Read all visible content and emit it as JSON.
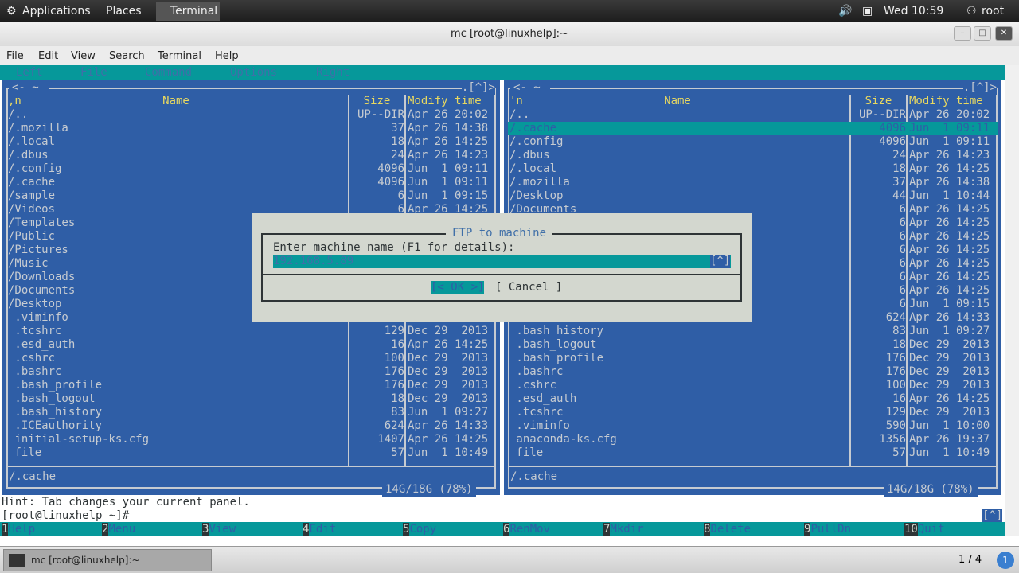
{
  "topbar": {
    "applications": "Applications",
    "places": "Places",
    "terminal": "Terminal",
    "clock": "Wed 10:59",
    "user": "root"
  },
  "window": {
    "title": "mc [root@linuxhelp]:~"
  },
  "menu": [
    "File",
    "Edit",
    "View",
    "Search",
    "Terminal",
    "Help"
  ],
  "mc_menu": [
    "Left",
    "File",
    "Command",
    "Options",
    "Right"
  ],
  "left_panel": {
    "path": "~",
    "corner": ".[^]>",
    "sort": ",n",
    "col_name": "Name",
    "col_size": "Size",
    "col_time": "Modify time",
    "status": "/.cache",
    "disk": "14G/18G (78%)",
    "rows": [
      [
        "/..",
        "UP--DIR",
        "Apr 26 20:02"
      ],
      [
        "/.mozilla",
        "37",
        "Apr 26 14:38"
      ],
      [
        "/.local",
        "18",
        "Apr 26 14:25"
      ],
      [
        "/.dbus",
        "24",
        "Apr 26 14:23"
      ],
      [
        "/.config",
        "4096",
        "Jun  1 09:11"
      ],
      [
        "/.cache",
        "4096",
        "Jun  1 09:11"
      ],
      [
        "/sample",
        "6",
        "Jun  1 09:15"
      ],
      [
        "/Videos",
        "6",
        "Apr 26 14:25"
      ],
      [
        "/Templates",
        "",
        ""
      ],
      [
        "/Public",
        "",
        ""
      ],
      [
        "/Pictures",
        "",
        ""
      ],
      [
        "/Music",
        "",
        ""
      ],
      [
        "/Downloads",
        "",
        ""
      ],
      [
        "/Documents",
        "",
        ""
      ],
      [
        "/Desktop",
        "",
        ""
      ],
      [
        " .viminfo",
        "",
        ""
      ],
      [
        " .tcshrc",
        "129",
        "Dec 29  2013"
      ],
      [
        " .esd_auth",
        "16",
        "Apr 26 14:25"
      ],
      [
        " .cshrc",
        "100",
        "Dec 29  2013"
      ],
      [
        " .bashrc",
        "176",
        "Dec 29  2013"
      ],
      [
        " .bash_profile",
        "176",
        "Dec 29  2013"
      ],
      [
        " .bash_logout",
        "18",
        "Dec 29  2013"
      ],
      [
        " .bash_history",
        "83",
        "Jun  1 09:27"
      ],
      [
        " .ICEauthority",
        "624",
        "Apr 26 14:33"
      ],
      [
        " initial-setup-ks.cfg",
        "1407",
        "Apr 26 14:25"
      ],
      [
        " file",
        "57",
        "Jun  1 10:49"
      ]
    ]
  },
  "right_panel": {
    "path": "~",
    "corner": ".[^]>",
    "sort": "'n",
    "col_name": "Name",
    "col_size": "Size",
    "col_time": "Modify time",
    "status": "/.cache",
    "disk": "14G/18G (78%)",
    "selected_index": 1,
    "rows": [
      [
        "/..",
        "UP--DIR",
        "Apr 26 20:02"
      ],
      [
        "/.cache",
        "4096",
        "Jun  1 09:11"
      ],
      [
        "/.config",
        "4096",
        "Jun  1 09:11"
      ],
      [
        "/.dbus",
        "24",
        "Apr 26 14:23"
      ],
      [
        "/.local",
        "18",
        "Apr 26 14:25"
      ],
      [
        "/.mozilla",
        "37",
        "Apr 26 14:38"
      ],
      [
        "/Desktop",
        "44",
        "Jun  1 10:44"
      ],
      [
        "/Documents",
        "6",
        "Apr 26 14:25"
      ],
      [
        "",
        "6",
        "Apr 26 14:25"
      ],
      [
        "",
        "6",
        "Apr 26 14:25"
      ],
      [
        "",
        "6",
        "Apr 26 14:25"
      ],
      [
        "",
        "6",
        "Apr 26 14:25"
      ],
      [
        "",
        "6",
        "Apr 26 14:25"
      ],
      [
        "",
        "6",
        "Apr 26 14:25"
      ],
      [
        "",
        "6",
        "Jun  1 09:15"
      ],
      [
        "",
        "624",
        "Apr 26 14:33"
      ],
      [
        " .bash_history",
        "83",
        "Jun  1 09:27"
      ],
      [
        " .bash_logout",
        "18",
        "Dec 29  2013"
      ],
      [
        " .bash_profile",
        "176",
        "Dec 29  2013"
      ],
      [
        " .bashrc",
        "176",
        "Dec 29  2013"
      ],
      [
        " .cshrc",
        "100",
        "Dec 29  2013"
      ],
      [
        " .esd_auth",
        "16",
        "Apr 26 14:25"
      ],
      [
        " .tcshrc",
        "129",
        "Dec 29  2013"
      ],
      [
        " .viminfo",
        "590",
        "Jun  1 10:00"
      ],
      [
        " anaconda-ks.cfg",
        "1356",
        "Apr 26 19:37"
      ],
      [
        " file",
        "57",
        "Jun  1 10:49"
      ]
    ]
  },
  "dialog": {
    "title": "FTP to machine",
    "label": "Enter machine name (F1 for details):",
    "value": "192.168.5.89",
    "history": "[^]",
    "ok": "[< OK >]",
    "cancel": "[ Cancel ]"
  },
  "hint": "Hint: Tab changes your current panel.",
  "prompt": "[root@linuxhelp ~]#",
  "prompt_history": "[^]",
  "fkeys": [
    [
      "1",
      "Help"
    ],
    [
      "2",
      "Menu"
    ],
    [
      "3",
      "View"
    ],
    [
      "4",
      "Edit"
    ],
    [
      "5",
      "Copy"
    ],
    [
      "6",
      "RenMov"
    ],
    [
      "7",
      "Mkdir"
    ],
    [
      "8",
      "Delete"
    ],
    [
      "9",
      "PullDn"
    ],
    [
      "10",
      "Quit"
    ]
  ],
  "taskbar": {
    "item": "mc [root@linuxhelp]:~",
    "workspace": "1 / 4",
    "notifications": "1"
  },
  "colors": {
    "panel": "#2f5ea6",
    "accent": "#06989a",
    "header": "#e8d860",
    "dialog": "#d3d7cf"
  }
}
